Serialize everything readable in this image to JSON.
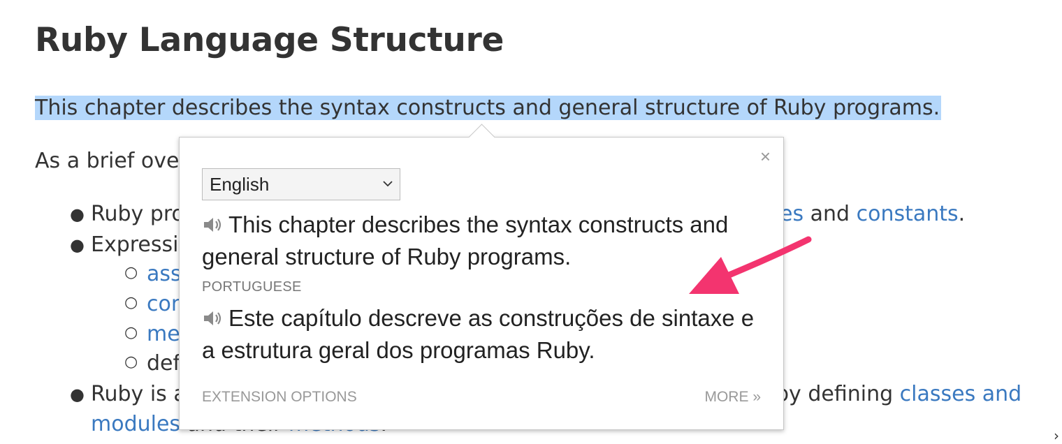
{
  "doc": {
    "title": "Ruby Language Structure",
    "intro": "This chapter describes the syntax constructs and general structure of Ruby programs.",
    "brief_prefix": "As a brief over",
    "b1_prefix": "Ruby pro",
    "b1_link_partial": "es",
    "b1_mid": " and ",
    "b1_link": "constants",
    "b1_end": ".",
    "b2_prefix": "Expressi",
    "sub1": "ass",
    "sub2": "con",
    "sub3": "me",
    "sub4": "def",
    "b3_prefix": "Ruby is a",
    "b3_right": "by defining ",
    "b3_link": "classes and",
    "b3_line2_link": "modules",
    "b3_line2_text": " and their ",
    "b3_line2_link2": "methods",
    "b3_line2_end": "."
  },
  "popup": {
    "close": "×",
    "language_selected": "English",
    "source_text": "This chapter describes the syntax constructs and general structure of Ruby programs.",
    "target_language": "PORTUGUESE",
    "translated_text": "Este capítulo descreve as construções de sintaxe e a estrutura geral dos programas Ruby.",
    "extension_options": "EXTENSION OPTIONS",
    "more": "MORE »"
  },
  "colors": {
    "highlight": "#b4d7fb",
    "link": "#3a79c0",
    "annotation_arrow": "#f3346f"
  },
  "icons": [
    "speaker-icon",
    "close-icon",
    "chevron-down-icon"
  ]
}
